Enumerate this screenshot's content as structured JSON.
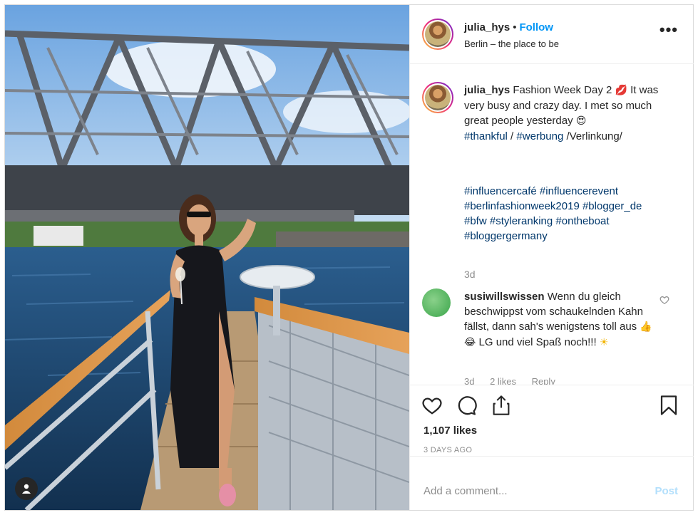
{
  "post": {
    "username": "julia_hys",
    "separator": "•",
    "follow_label": "Follow",
    "location": "Berlin – the place to be",
    "more_label": "•••"
  },
  "caption": {
    "username": "julia_hys",
    "text_1": "Fashion Week Day 2",
    "emoji_1": "💋",
    "text_2": "It was very busy and crazy day. I met so much great people yesterday",
    "emoji_2": "😍",
    "tag_thankful": "#thankful",
    "slash_1": " / ",
    "tag_werbung": "#werbung",
    "after_werbung": " /Verlinkung/",
    "hashtags": [
      "#influencercafé",
      "#influencerevent",
      "#berlinfashionweek2019",
      "#blogger_de",
      "#bfw",
      "#styleranking",
      "#ontheboat",
      "#bloggergermany"
    ],
    "time": "3d"
  },
  "comment": {
    "username": "susiwillswissen",
    "text_1": "Wenn du gleich beschwippst vom schaukelnden Kahn fällst, dann sah's wenigstens toll aus",
    "emoji_1": "👍😂",
    "text_2": "LG und viel Spaß noch!!!",
    "emoji_2": "☀",
    "time": "3d",
    "likes": "2 likes",
    "reply": "Reply"
  },
  "actions": {
    "likes": "1,107 likes",
    "date": "3 DAYS AGO"
  },
  "add_comment": {
    "placeholder": "Add a comment...",
    "post_label": "Post"
  },
  "icons": {
    "like": "heart-icon",
    "comment": "comment-bubble-icon",
    "share": "share-icon",
    "save": "bookmark-icon",
    "tag": "user-tag-icon"
  }
}
